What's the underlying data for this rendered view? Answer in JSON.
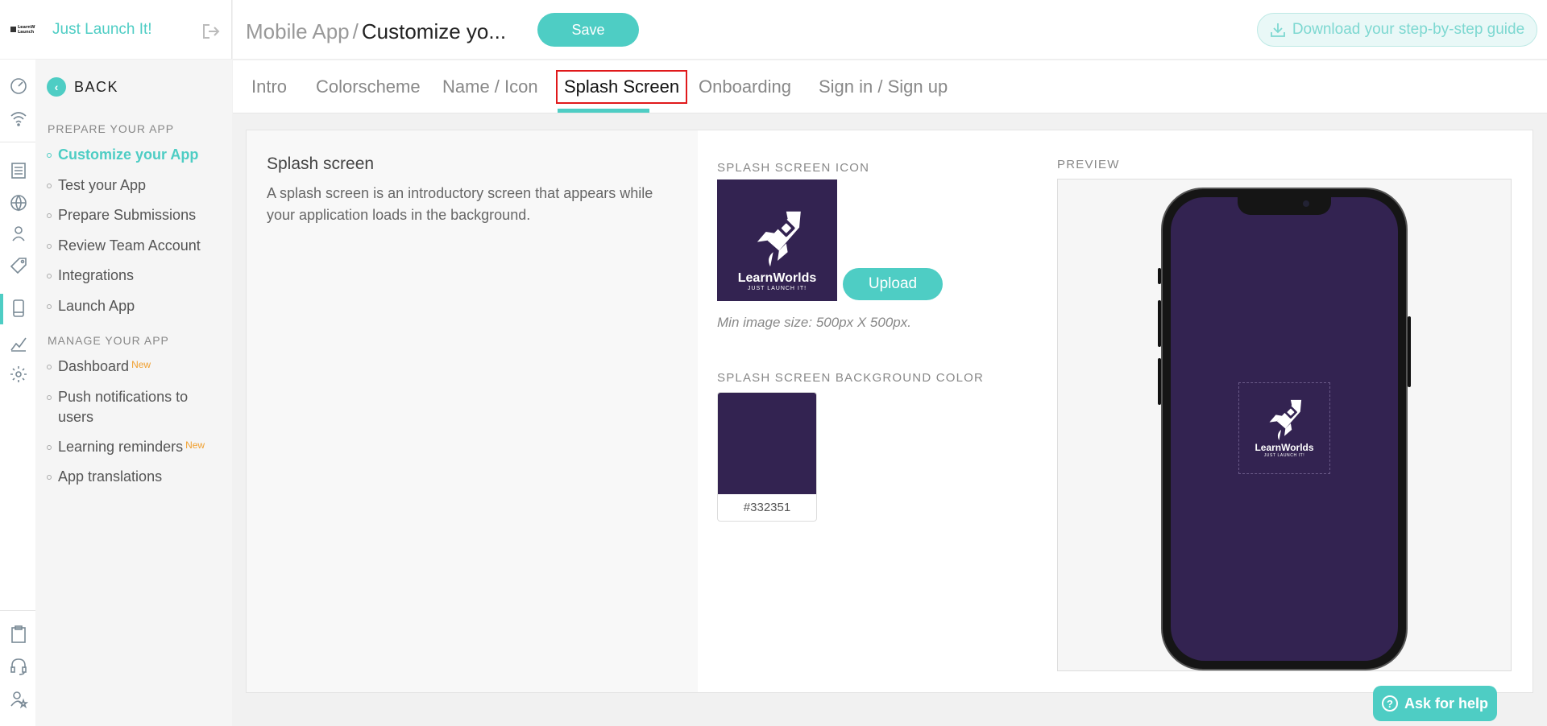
{
  "brand": {
    "logo_text": "LearnWorlds Just Launch It",
    "school_name": "Just Launch It!"
  },
  "nav": {
    "back_label": "BACK",
    "sections": [
      {
        "title": "PREPARE YOUR APP",
        "items": [
          {
            "label": "Customize your App",
            "active": true
          },
          {
            "label": "Test your App"
          },
          {
            "label": "Prepare Submissions"
          },
          {
            "label": "Review Team Account"
          },
          {
            "label": "Integrations"
          },
          {
            "label": "Launch App"
          }
        ]
      },
      {
        "title": "MANAGE YOUR APP",
        "items": [
          {
            "label": "Dashboard",
            "badge": "New"
          },
          {
            "label": "Push notifications to users"
          },
          {
            "label": "Learning reminders",
            "badge": "New"
          },
          {
            "label": "App translations"
          }
        ]
      }
    ]
  },
  "rail_icons": [
    "dashboard-gauge-icon",
    "wifi-icon",
    "pages-icon",
    "globe-icon",
    "users-icon",
    "tag-icon",
    "mobile-icon",
    "analytics-icon",
    "settings-icon",
    "clipboard-icon",
    "headset-icon",
    "user-star-icon"
  ],
  "header": {
    "breadcrumb_parent": "Mobile App",
    "breadcrumb_sep": "/",
    "breadcrumb_current": "Customize yo...",
    "save_label": "Save",
    "guide_label": "Download your step-by-step guide"
  },
  "tabs": [
    {
      "label": "Intro"
    },
    {
      "label": "Colorscheme"
    },
    {
      "label": "Name / Icon"
    },
    {
      "label": "Splash Screen",
      "active": true
    },
    {
      "label": "Onboarding"
    },
    {
      "label": "Sign in / Sign up"
    }
  ],
  "content": {
    "title": "Splash screen",
    "description": "A splash screen is an introductory screen that appears while your application loads in the background.",
    "icon_label": "SPLASH SCREEN ICON",
    "icon_brand": "LearnWorlds",
    "icon_tagline": "JUST LAUNCH IT!",
    "upload_label": "Upload",
    "min_size": "Min image size: 500px X 500px.",
    "bg_color_label": "SPLASH SCREEN BACKGROUND COLOR",
    "bg_color_hex": "#332351",
    "preview_label": "PREVIEW"
  },
  "colors": {
    "accent": "#4ecdc4",
    "splash_bg": "#332351",
    "badge_new": "#f0a030"
  },
  "help": {
    "label": "Ask for help"
  }
}
